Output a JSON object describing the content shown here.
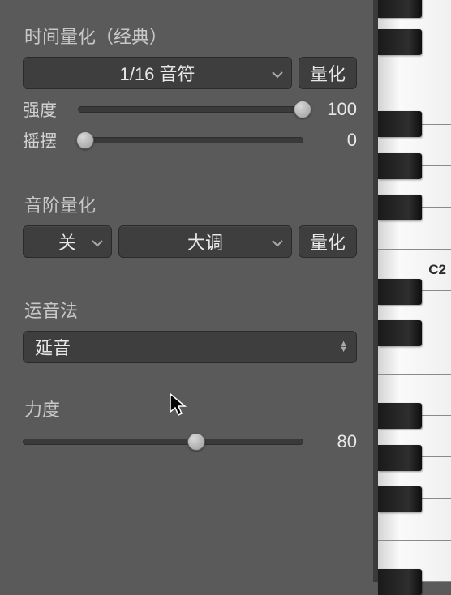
{
  "quantize": {
    "section_label": "时间量化（经典）",
    "note_value": "1/16 音符",
    "apply_label": "量化",
    "strength": {
      "label": "强度",
      "value": 100,
      "pct": 100
    },
    "swing": {
      "label": "摇摆",
      "value": 0,
      "pct": 0
    }
  },
  "scale_quantize": {
    "section_label": "音阶量化",
    "root": "关",
    "scale": "大调",
    "apply_label": "量化"
  },
  "articulation": {
    "section_label": "运音法",
    "value": "延音"
  },
  "velocity": {
    "section_label": "力度",
    "value": 80,
    "pct": 62
  },
  "keyboard": {
    "c2_label": "C2"
  }
}
